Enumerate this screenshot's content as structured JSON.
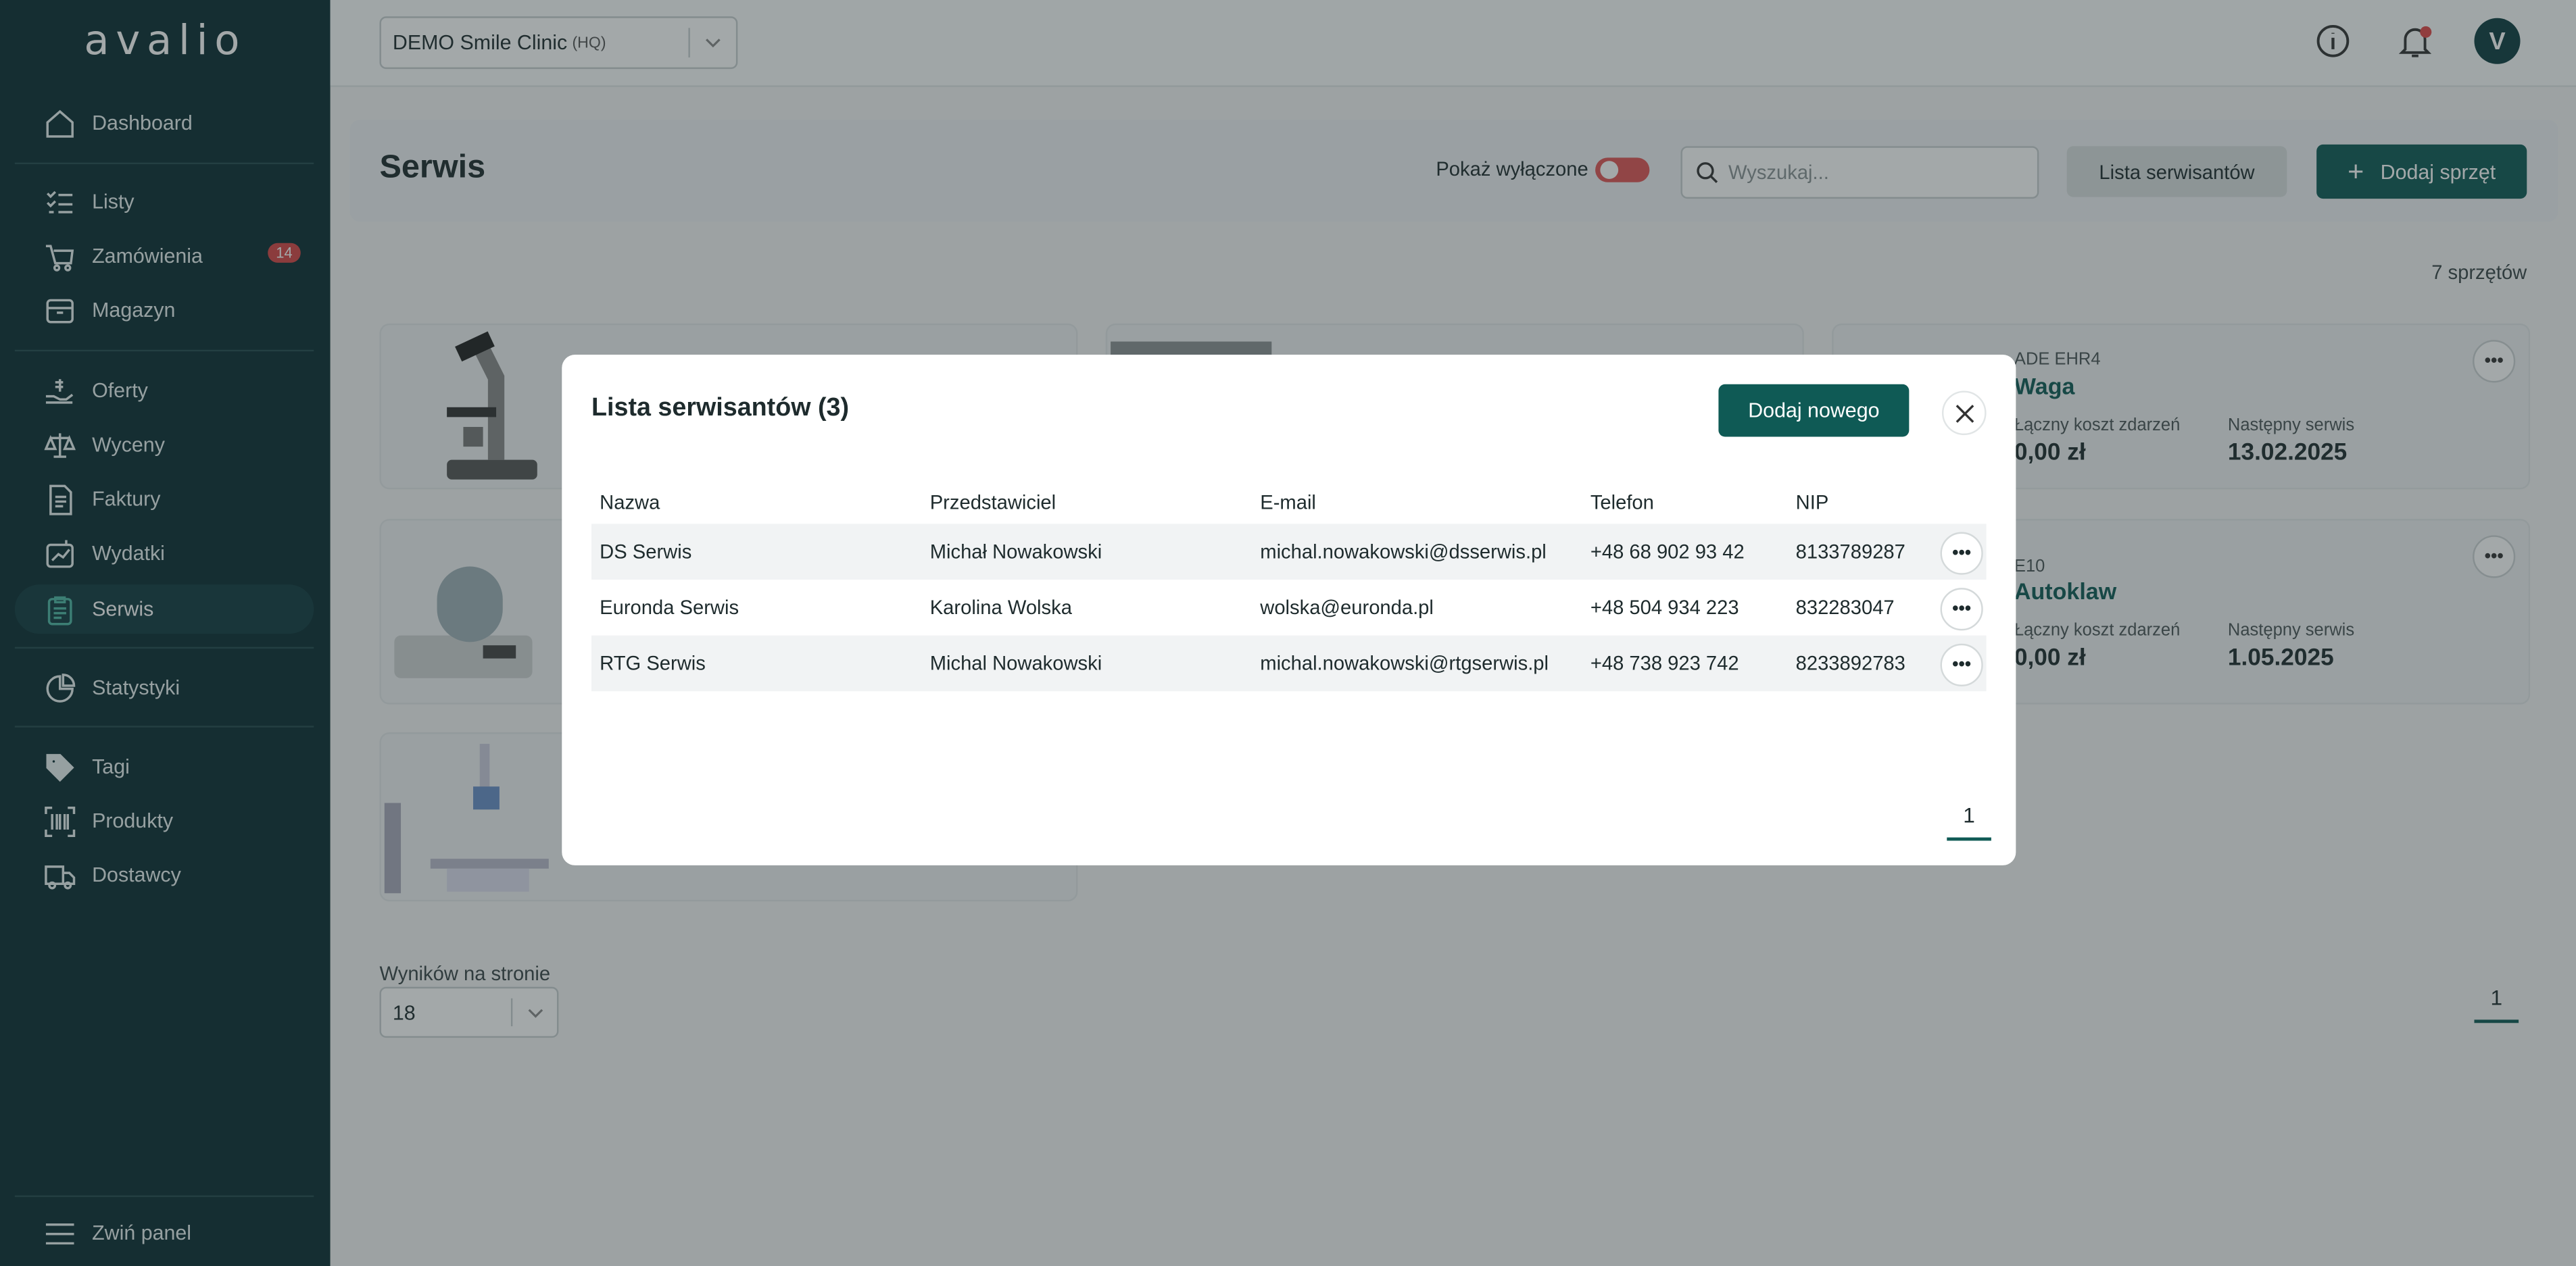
{
  "app": {
    "logo": "avalio"
  },
  "sidebar": {
    "items": [
      {
        "label": "Dashboard",
        "icon": "home-icon"
      },
      {
        "label": "Listy",
        "icon": "checklist-icon"
      },
      {
        "label": "Zamówienia",
        "icon": "cart-icon",
        "badge": "14"
      },
      {
        "label": "Magazyn",
        "icon": "box-icon"
      },
      {
        "label": "Oferty",
        "icon": "hand-coin-icon"
      },
      {
        "label": "Wyceny",
        "icon": "scale-icon"
      },
      {
        "label": "Faktury",
        "icon": "invoice-icon"
      },
      {
        "label": "Wydatki",
        "icon": "chart-wallet-icon"
      },
      {
        "label": "Serwis",
        "icon": "clipboard-icon",
        "active": true
      },
      {
        "label": "Statystyki",
        "icon": "pie-chart-icon"
      },
      {
        "label": "Tagi",
        "icon": "tag-icon"
      },
      {
        "label": "Produkty",
        "icon": "barcode-icon"
      },
      {
        "label": "Dostawcy",
        "icon": "truck-icon"
      }
    ],
    "collapse_label": "Zwiń panel"
  },
  "header": {
    "clinic_name": "DEMO Smile Clinic",
    "clinic_suffix": "(HQ)",
    "avatar_letter": "V"
  },
  "page": {
    "title": "Serwis",
    "toggle_label": "Pokaż wyłączone",
    "search_placeholder": "Wyszukaj...",
    "technicians_button": "Lista serwisantów",
    "add_button": "Dodaj sprzęt",
    "count_text": "7 sprzętów",
    "per_page_label": "Wyników na stronie",
    "per_page_value": "18",
    "page_number": "1"
  },
  "cards": [
    {
      "code": "ADE EHR4",
      "title": "Waga",
      "cost_label": "Łączny koszt zdarzeń",
      "cost_value": "0,00 zł",
      "next_label": "Następny serwis",
      "next_value": "13.02.2025"
    },
    {
      "code": "E10",
      "title": "Autoklaw",
      "cost_label": "Łączny koszt zdarzeń",
      "cost_value": "0,00 zł",
      "next_label": "Następny serwis",
      "next_value": "1.05.2025"
    }
  ],
  "modal": {
    "title": "Lista serwisantów (3)",
    "add_button": "Dodaj nowego",
    "columns": [
      "Nazwa",
      "Przedstawiciel",
      "E-mail",
      "Telefon",
      "NIP"
    ],
    "rows": [
      [
        "DS Serwis",
        "Michał Nowakowski",
        "michal.nowakowski@dsserwis.pl",
        "+48 68 902 93 42",
        "8133789287"
      ],
      [
        "Euronda Serwis",
        "Karolina Wolska",
        "wolska@euronda.pl",
        "+48 504 934 223",
        "832283047"
      ],
      [
        "RTG Serwis",
        "Michal Nowakowski",
        "michal.nowakowski@rtgserwis.pl",
        "+48 738 923 742",
        "8233892783"
      ]
    ],
    "page_number": "1"
  },
  "colors": {
    "sidebar_bg": "#0b2e33",
    "accent": "#0f5a55",
    "badge": "#d64545"
  }
}
